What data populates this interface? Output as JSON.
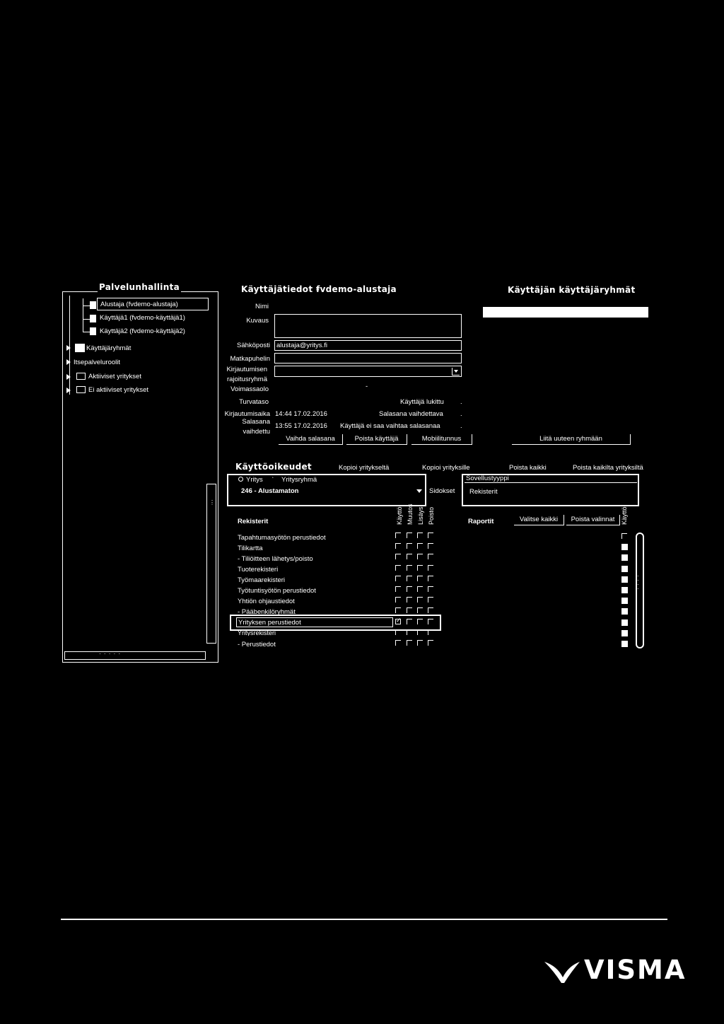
{
  "left_panel": {
    "title": "Palvelunhallinta",
    "tree": {
      "users": [
        "Alustaja (fvdemo-alustaja)",
        "Käyttäjä1 (fvdemo-käyttäjä1)",
        "Käyttäjä2 (fvdemo-käyttäjä2)"
      ],
      "groups": [
        "Käyttäjäryhmät",
        "Itsepalveluroolit",
        "Aktiiviset yritykset",
        "Ei aktiiviset yritykset"
      ]
    }
  },
  "user_info": {
    "title": "Käyttäjätiedot -",
    "username": "fvdemo-alustaja",
    "labels": {
      "name": "Nimi",
      "description": "Kuvaus",
      "email": "Sähköposti",
      "mobile": "Matkapuhelin",
      "login_group_1": "Kirjautumisen",
      "login_group_2": "rajoitusryhmä",
      "validity": "Voimassaolo",
      "security": "Turvataso",
      "login_time": "Kirjautumisaika",
      "pwd_changed_1": "Salasana",
      "pwd_changed_2": "vaihdettu"
    },
    "values": {
      "email": "alustaja@yritys.fi",
      "validity_sep": "-",
      "login_time": "14:44 17.02.2016",
      "pwd_changed": "13:55 17.02.2016"
    },
    "flags": {
      "locked": "Käyttäjä lukittu",
      "pwd_required": "Salasana vaihdettava",
      "cannot_change": "Käyttäjä ei saa vaihtaa salasanaa",
      "dot": "."
    },
    "buttons": {
      "change_pwd": "Vaihda salasana",
      "delete_user": "Poista käyttäjä",
      "mobile_id": "Mobiilitunnus"
    }
  },
  "user_groups": {
    "title": "Käyttäjän käyttäjäryhmät",
    "add_button": "Liitä uuteen ryhmään"
  },
  "permissions": {
    "title": "Käyttöoikeudet",
    "links": [
      "Kopioi yritykseltä",
      "Kopioi yrityksille",
      "Poista kaikki",
      "Poista kaikilta yrityksiltä"
    ],
    "radio_company": "Yritys",
    "radio_group": "Yritysryhmä",
    "company_select": "246 - Alustamaton",
    "bindings": "Sidokset",
    "app_type_label": "Sovellustyyppi",
    "app_type_value": "Rekisterit",
    "registers_header": "Rekisterit",
    "columns": [
      "Käyttö",
      "Muutos",
      "Lisäys",
      "Poisto"
    ],
    "reports_header": "Raportit",
    "select_all": "Valitse kaikki",
    "clear_selection": "Poista valinnat",
    "reports_col": "Käyttö",
    "rows": [
      "Tapahtumasyötön perustiedot",
      "Tilikartta",
      "- Tiliöitteen lähetys/poisto",
      "Tuoterekisteri",
      "Työmaarekisteri",
      "Työtuntisyötön perustiedot",
      "Yhtiön ohjaustiedot",
      "- Pääbenkilöryhmät",
      "Yrityksen perustiedot",
      "Yritysrekisteri",
      "- Perustiedot"
    ]
  },
  "footer": {
    "logo": "VISMA"
  }
}
